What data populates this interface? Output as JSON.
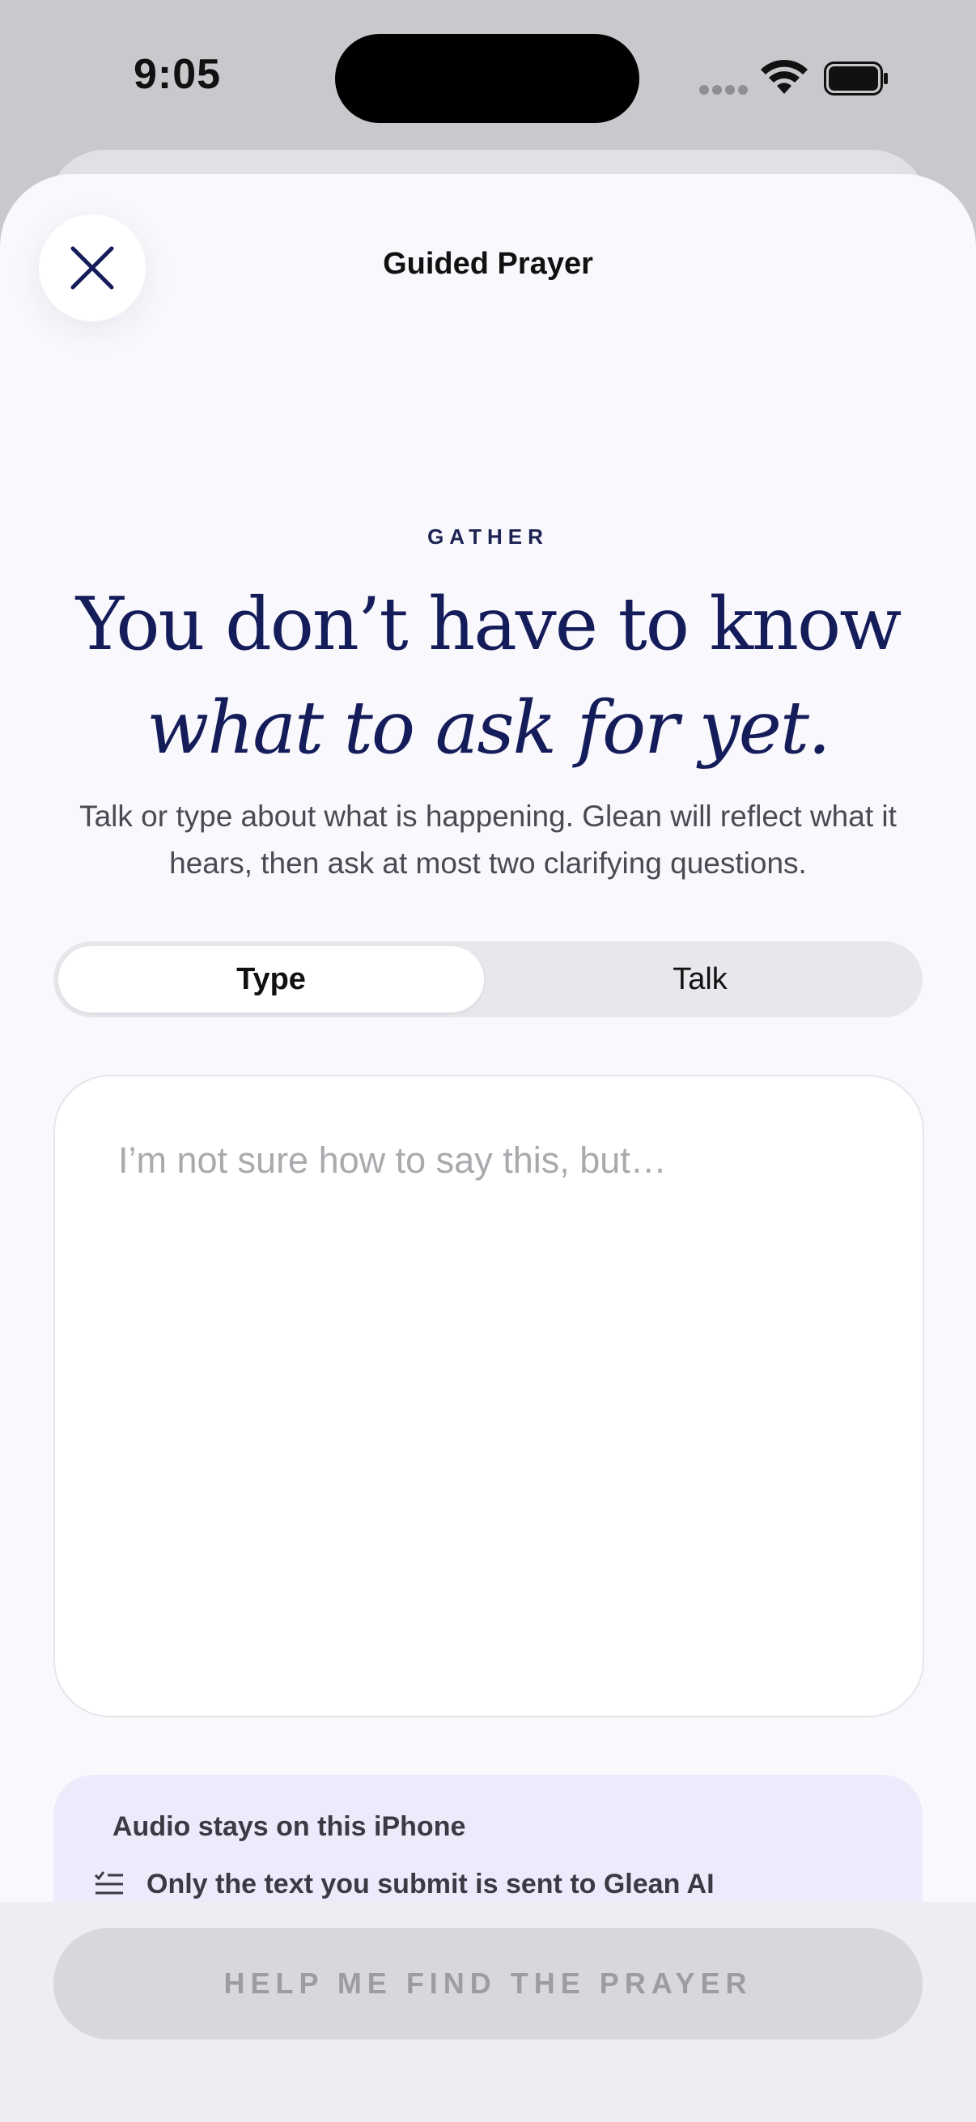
{
  "status_bar": {
    "time": "9:05"
  },
  "nav": {
    "title": "Guided Prayer",
    "close_icon": "close-icon"
  },
  "intro": {
    "eyebrow": "GATHER",
    "headline_line1": "You don’t have to know",
    "headline_line2": "what to ask for yet.",
    "subtitle": "Talk or type about what is happening. Glean will reflect what it hears, then ask at most two clarifying questions."
  },
  "mode_toggle": {
    "type_label": "Type",
    "talk_label": "Talk",
    "selected": "Type"
  },
  "entry": {
    "placeholder": "I’m not sure how to say this, but…",
    "value": ""
  },
  "privacy": {
    "title": "Audio stays on this iPhone",
    "line": "Only the text you submit is sent to Glean AI",
    "line_icon": "list-check-icon"
  },
  "cta": {
    "label": "HELP ME FIND THE PRAYER",
    "enabled": false
  },
  "colors": {
    "accent_navy": "#141d5a",
    "sheet_bg": "#f9f8fc",
    "privacy_bg": "#ecebfb"
  }
}
